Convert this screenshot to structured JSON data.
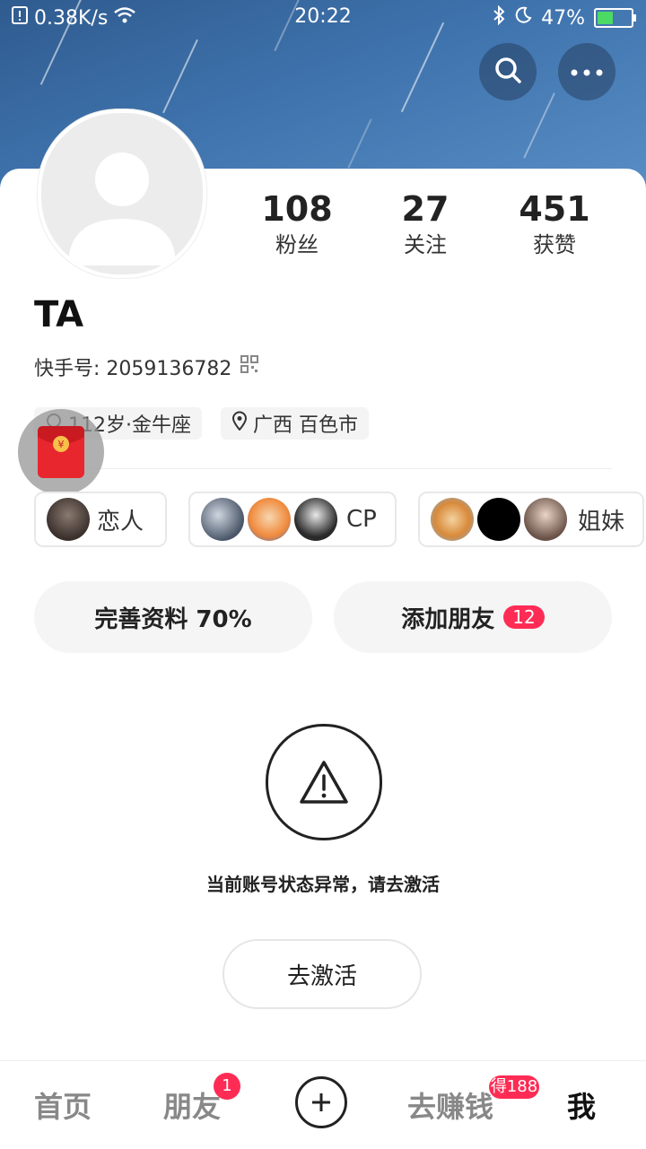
{
  "status_bar": {
    "network_speed": "0.38K/s",
    "time": "20:22",
    "battery_percent": "47%",
    "battery_level": 0.47
  },
  "profile": {
    "stats": [
      {
        "value": "108",
        "label": "粉丝"
      },
      {
        "value": "27",
        "label": "关注"
      },
      {
        "value": "451",
        "label": "获赞"
      }
    ],
    "name": "TA",
    "kuaishou_id": "快手号: 2059136782",
    "tags": {
      "age_zodiac": "112岁·金牛座",
      "location": "广西 百色市"
    }
  },
  "relations": [
    {
      "label": "恋人"
    },
    {
      "label": "CP"
    },
    {
      "label": "姐妹"
    }
  ],
  "actions": {
    "complete_profile": "完善资料 70%",
    "add_friend": "添加朋友",
    "add_friend_badge": "12"
  },
  "notice": {
    "message": "当前账号状态异常，请去激活",
    "activate_button": "去激活"
  },
  "tab_bar": {
    "home": "首页",
    "friends": "朋友",
    "friends_badge": "1",
    "earn": "去赚钱",
    "earn_badge": "得188",
    "me": "我"
  },
  "colors": {
    "accent": "#fe2c55",
    "banner": "#3f73ad"
  }
}
